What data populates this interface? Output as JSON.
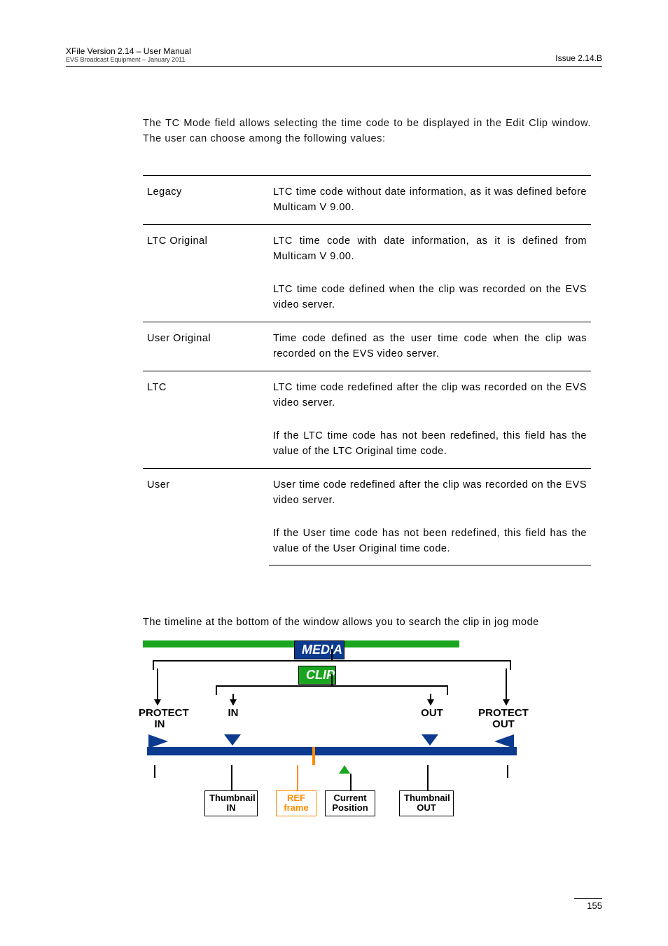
{
  "header": {
    "left1": "XFile Version 2.14 – User Manual",
    "left2": "EVS Broadcast Equipment – January 2011",
    "right": "Issue 2.14.B"
  },
  "intro": "The TC Mode field allows selecting the time code to be displayed in the Edit Clip window. The user can choose among the following values:",
  "rows": {
    "legacy": {
      "label": "Legacy",
      "desc": "LTC time code without date information, as it was defined before Multicam V 9.00."
    },
    "ltcorig": {
      "label": "LTC Original",
      "desc1": "LTC time code with date information, as it is defined from Multicam V 9.00.",
      "desc2": "LTC time code defined when the clip was recorded on the EVS video server."
    },
    "userorig": {
      "label": "User Original",
      "desc": "Time code defined as the user time code when the clip was recorded on the EVS video server."
    },
    "ltc": {
      "label": "LTC",
      "desc1": "LTC time code redefined after the clip was recorded on the EVS video server.",
      "desc2": "If the LTC time code has not been redefined, this field has the value of the LTC Original time code."
    },
    "user": {
      "label": "User",
      "desc1": "User time code redefined after the clip was recorded on the EVS video server.",
      "desc2": "If the User time code has not been redefined, this field has the value of the User Original time code."
    }
  },
  "timeline_text": "The timeline at the bottom of the window allows you to search the clip in jog mode",
  "diagram": {
    "media": "MEDIA",
    "clip": "CLIP",
    "protect_in": "PROTECT IN",
    "in": "IN",
    "out": "OUT",
    "protect_out": "PROTECT OUT",
    "thumb_in": "Thumbnail IN",
    "ref": "REF frame",
    "cur": "Current Position",
    "thumb_out": "Thumbnail OUT"
  },
  "page_number": "155"
}
